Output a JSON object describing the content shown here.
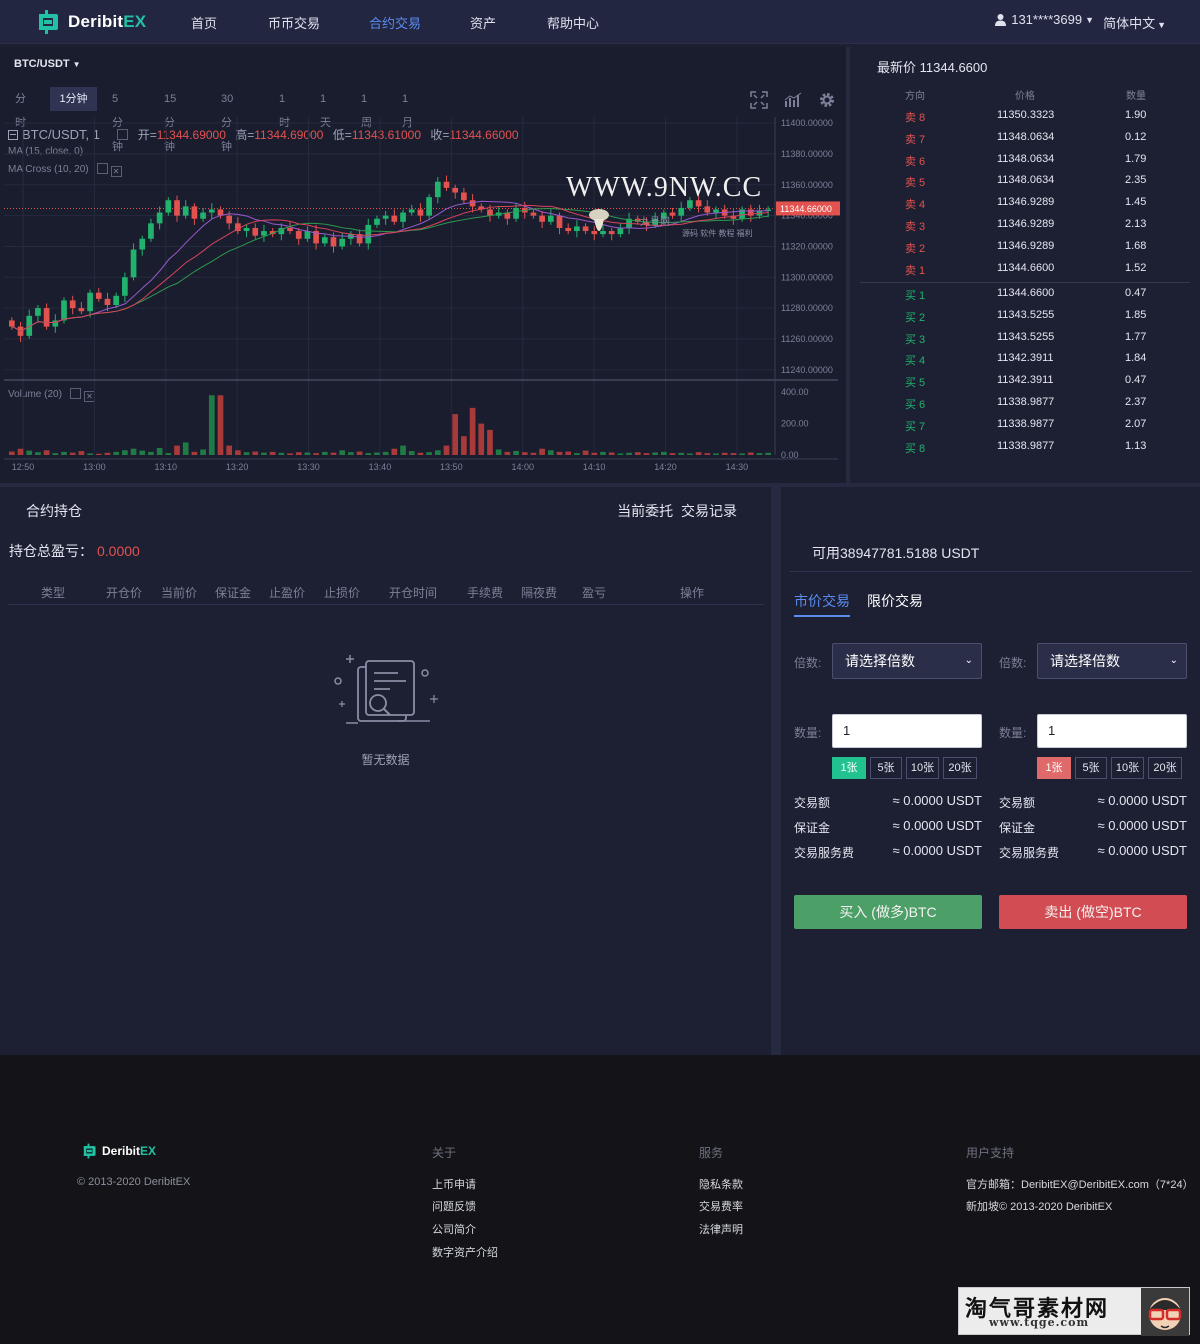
{
  "nav": {
    "logo_main": "Deribit",
    "logo_ex": "EX",
    "items": [
      "首页",
      "币币交易",
      "合约交易",
      "资产",
      "帮助中心"
    ],
    "active_index": 2,
    "user": "131****3699",
    "lang": "简体中文"
  },
  "chart": {
    "symbol": "BTC/USDT",
    "intervals": [
      "分时",
      "1分钟",
      "5分钟",
      "15分钟",
      "30分钟",
      "1时",
      "1天",
      "1周",
      "1月"
    ],
    "active_interval": 1,
    "title": "BTC/USDT, 1",
    "open_label": "开=",
    "open": "11344.69000",
    "high_label": "高=",
    "high": "11344.69000",
    "low_label": "低=",
    "low": "11343.61000",
    "close_label": "收=",
    "close": "11344.66000",
    "ma_label": "MA (15, close, 0)",
    "ma_cross_label": "MA Cross (10, 20)",
    "volume_label": "Volume (20)",
    "watermark": "WWW.9NW.CC",
    "watermark_sub": "九号网",
    "watermark_tags": "源码 软件 教程 福利",
    "colors": {
      "up": "#21b26e",
      "down": "#e2524f",
      "ma_red": "#d9435a",
      "ma_purple": "#9b59d0",
      "ma_green": "#2d9a4e",
      "accent": "#5b8cf0"
    }
  },
  "chart_data": {
    "type": "candlestick",
    "x_ticks": [
      "12:50",
      "13:00",
      "13:10",
      "13:20",
      "13:30",
      "13:40",
      "13:50",
      "14:00",
      "14:10",
      "14:20",
      "14:30"
    ],
    "y_ticks": [
      "11400.00000",
      "11380.00000",
      "11360.00000",
      "11340.00000",
      "11320.00000",
      "11300.00000",
      "11280.00000",
      "11260.00000",
      "11240.00000"
    ],
    "ylim": [
      11234,
      11404
    ],
    "last_price": "11344.66000",
    "closes": [
      11268,
      11262,
      11275,
      11280,
      11268,
      11272,
      11285,
      11280,
      11278,
      11290,
      11286,
      11282,
      11288,
      11300,
      11318,
      11325,
      11335,
      11342,
      11350,
      11340,
      11346,
      11338,
      11342,
      11344,
      11340,
      11335,
      11330,
      11332,
      11327,
      11330,
      11328,
      11332,
      11330,
      11325,
      11330,
      11322,
      11326,
      11320,
      11325,
      11328,
      11322,
      11334,
      11338,
      11340,
      11336,
      11342,
      11344,
      11340,
      11352,
      11362,
      11358,
      11355,
      11350,
      11346,
      11344,
      11340,
      11342,
      11338,
      11345,
      11342,
      11340,
      11336,
      11340,
      11332,
      11330,
      11333,
      11330,
      11328,
      11330,
      11328,
      11332,
      11338,
      11336,
      11334,
      11338,
      11342,
      11340,
      11345,
      11350,
      11346,
      11342,
      11344,
      11340,
      11338,
      11344,
      11340,
      11343,
      11344
    ],
    "volume_ticks": [
      "400.00",
      "200.00",
      "0.00"
    ],
    "volume_ylim": [
      0,
      420
    ],
    "volumes": [
      22,
      40,
      28,
      18,
      30,
      12,
      20,
      15,
      25,
      10,
      8,
      14,
      20,
      30,
      40,
      28,
      20,
      45,
      12,
      60,
      80,
      20,
      35,
      380,
      380,
      60,
      30,
      18,
      22,
      15,
      20,
      14,
      10,
      18,
      16,
      12,
      20,
      15,
      30,
      18,
      22,
      12,
      16,
      20,
      40,
      60,
      25,
      14,
      18,
      30,
      60,
      260,
      120,
      300,
      200,
      160,
      35,
      20,
      26,
      18,
      14,
      40,
      30,
      20,
      22,
      12,
      28,
      14,
      20,
      16,
      10,
      14,
      18,
      12,
      16,
      20,
      12,
      14,
      10,
      18,
      12,
      10,
      14,
      12,
      10,
      16,
      12,
      14
    ]
  },
  "orderbook": {
    "latest_label": "最新价",
    "latest_price": "11344.6600",
    "headers": [
      "方向",
      "价格",
      "数量"
    ],
    "asks": [
      {
        "side": "卖 8",
        "price": "11350.3323",
        "qty": "1.90"
      },
      {
        "side": "卖 7",
        "price": "11348.0634",
        "qty": "0.12"
      },
      {
        "side": "卖 6",
        "price": "11348.0634",
        "qty": "1.79"
      },
      {
        "side": "卖 5",
        "price": "11348.0634",
        "qty": "2.35"
      },
      {
        "side": "卖 4",
        "price": "11346.9289",
        "qty": "1.45"
      },
      {
        "side": "卖 3",
        "price": "11346.9289",
        "qty": "2.13"
      },
      {
        "side": "卖 2",
        "price": "11346.9289",
        "qty": "1.68"
      },
      {
        "side": "卖 1",
        "price": "11344.6600",
        "qty": "1.52"
      }
    ],
    "bids": [
      {
        "side": "买 1",
        "price": "11344.6600",
        "qty": "0.47"
      },
      {
        "side": "买 2",
        "price": "11343.5255",
        "qty": "1.85"
      },
      {
        "side": "买 3",
        "price": "11343.5255",
        "qty": "1.77"
      },
      {
        "side": "买 4",
        "price": "11342.3911",
        "qty": "1.84"
      },
      {
        "side": "买 5",
        "price": "11342.3911",
        "qty": "0.47"
      },
      {
        "side": "买 6",
        "price": "11338.9877",
        "qty": "2.37"
      },
      {
        "side": "买 7",
        "price": "11338.9877",
        "qty": "2.07"
      },
      {
        "side": "买 8",
        "price": "11338.9877",
        "qty": "1.13"
      }
    ]
  },
  "positions": {
    "title": "合约持仓",
    "tab_orders": "当前委托",
    "tab_history": "交易记录",
    "pnl_label": "持仓总盈亏：",
    "pnl_value": "0.0000",
    "columns": [
      "类型",
      "开仓价",
      "当前价",
      "保证金",
      "止盈价",
      "止损价",
      "开仓时间",
      "手续费",
      "隔夜费",
      "盈亏",
      "操作"
    ],
    "empty_text": "暂无数据"
  },
  "trade": {
    "balance": "可用38947781.5188 USDT",
    "tab_market": "市价交易",
    "tab_limit": "限价交易",
    "leverage_label": "倍数:",
    "leverage_placeholder": "请选择倍数",
    "qty_label": "数量:",
    "qty_value": "1",
    "lots": [
      "1张",
      "5张",
      "10张",
      "20张"
    ],
    "info_labels": [
      "交易额",
      "保证金",
      "交易服务费"
    ],
    "info_value": "≈ 0.0000 USDT",
    "buy_label": "买入 (做多)BTC",
    "sell_label": "卖出 (做空)BTC"
  },
  "footer": {
    "copyright": "© 2013-2020 DeribitEX",
    "about_title": "关于",
    "about_links": [
      "上币申请",
      "问题反馈",
      "公司简介",
      "数字资产介绍"
    ],
    "service_title": "服务",
    "service_links": [
      "隐私条款",
      "交易费率",
      "法律声明"
    ],
    "support_title": "用户支持",
    "support_email": "官方邮箱：DeribitEX@DeribitEX.com（7*24）",
    "support_copy": "新加坡© 2013-2020 DeribitEX",
    "badge_main": "淘气哥素材网",
    "badge_sub": "www.tqge.com"
  }
}
